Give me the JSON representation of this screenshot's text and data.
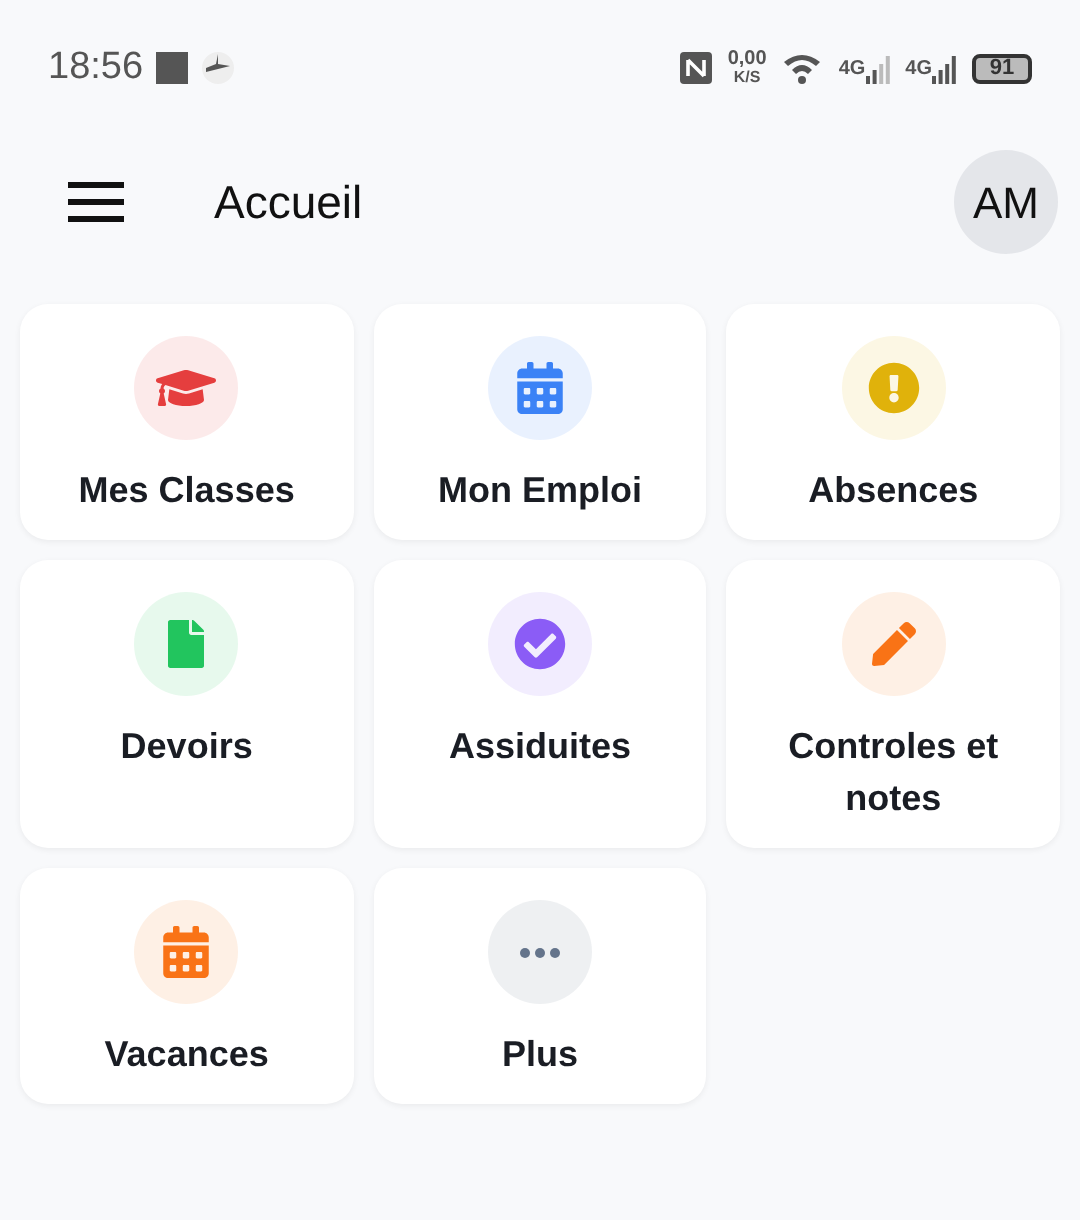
{
  "status_bar": {
    "time": "18:56",
    "speed_value": "0,00",
    "speed_unit": "K/S",
    "network_1": "4G",
    "network_2": "4G",
    "battery": "91"
  },
  "header": {
    "title": "Accueil",
    "avatar": "AM"
  },
  "tiles": [
    {
      "label": "Mes Classes",
      "kind": "graduation",
      "color": "#e53e3e"
    },
    {
      "label": "Mon Emploi",
      "kind": "calendar",
      "color": "#3b82f6"
    },
    {
      "label": "Absences",
      "kind": "alert",
      "color": "#e0b20b"
    },
    {
      "label": "Devoirs",
      "kind": "file",
      "color": "#22c55e"
    },
    {
      "label": "Assiduites",
      "kind": "check",
      "color": "#8b5cf6"
    },
    {
      "label": "Controles et notes",
      "kind": "pencil",
      "color": "#f97316"
    },
    {
      "label": "Vacances",
      "kind": "calendar",
      "color": "#f97316"
    },
    {
      "label": "Plus",
      "kind": "dots",
      "color": "#64748b"
    }
  ]
}
